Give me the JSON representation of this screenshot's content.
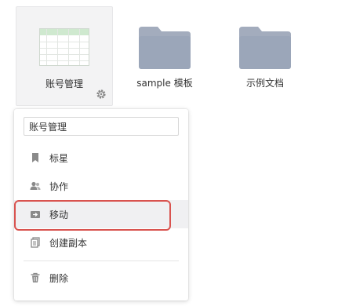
{
  "files": [
    {
      "name": "账号管理",
      "type": "sheet"
    },
    {
      "name": "sample 模板",
      "type": "folder"
    },
    {
      "name": "示例文档",
      "type": "folder"
    }
  ],
  "menu": {
    "rename_value": "账号管理",
    "items": [
      {
        "label": "标星",
        "icon": "bookmark-icon"
      },
      {
        "label": "协作",
        "icon": "people-icon"
      },
      {
        "label": "移动",
        "icon": "move-icon"
      },
      {
        "label": "创建副本",
        "icon": "copy-icon"
      },
      {
        "label": "删除",
        "icon": "trash-icon"
      }
    ]
  },
  "colors": {
    "folder": "#a3acbd",
    "highlight": "#d9534f",
    "sheet_header": "#cfe9cf"
  }
}
